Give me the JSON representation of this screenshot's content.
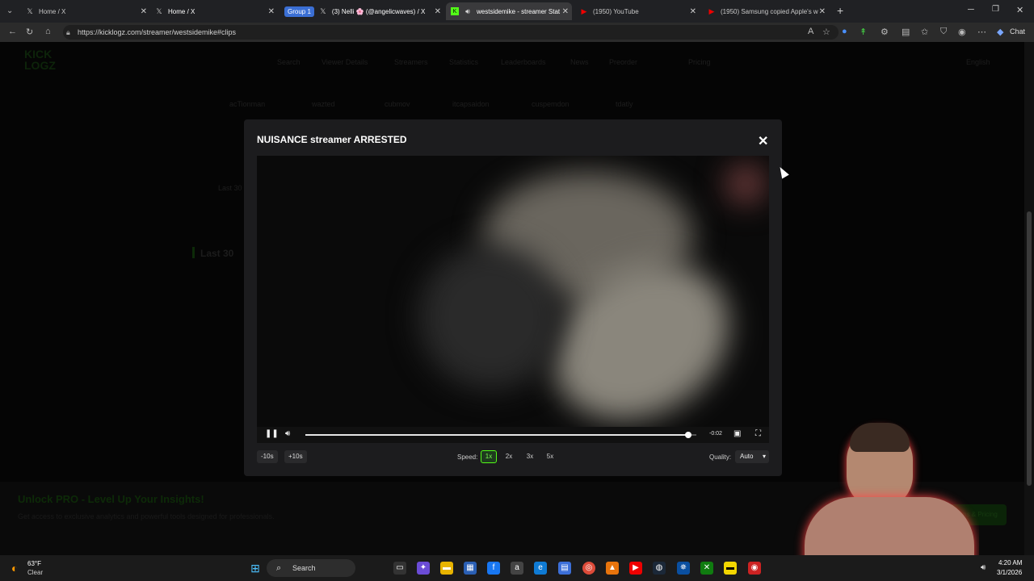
{
  "browser": {
    "tabs": [
      {
        "label": "Home / X",
        "icon": "x-logo-icon"
      },
      {
        "label": "Home / X",
        "icon": "x-logo-icon"
      },
      {
        "group": "Group 1",
        "label": "(3) Nelli 🌸 (@angelicwaves) / X",
        "icon": "x-logo-icon"
      },
      {
        "label": "westsidemike - streamer Stat",
        "icon": "kick-icon",
        "active": true
      },
      {
        "label": "(1950) YouTube",
        "icon": "youtube-icon"
      },
      {
        "label": "(1950) Samsung copied Apple's w",
        "icon": "youtube-icon"
      }
    ],
    "url": "https://kicklogz.com/streamer/westsidemike#clips",
    "chat_label": "Chat"
  },
  "site": {
    "logo": "KICK LOGZ",
    "nav": [
      "Search",
      "Viewer Details",
      "Streamers",
      "Statistics",
      "Leaderboards",
      "News",
      "Preorder",
      "Pricing"
    ],
    "language": "English",
    "users": [
      "acTionman",
      "wazted",
      "cubmov",
      "itcapsaidon",
      "cuspemdon",
      "tdatly"
    ],
    "section_small": "Last 30",
    "section_heading": "Last 30",
    "promo_title": "Unlock PRO - Level Up Your Insights!",
    "promo_sub": "Get access to exclusive analytics and powerful tools designed for professionals.",
    "promo_button": "View Plans & Pricing"
  },
  "modal": {
    "title": "NUISANCE streamer ARRESTED",
    "time_remaining": "-0:02",
    "progress": 0.98,
    "skip_back": "-10s",
    "skip_forward": "+10s",
    "speed_label": "Speed:",
    "speeds": [
      "1x",
      "2x",
      "3x",
      "5x"
    ],
    "active_speed": "1x",
    "quality_label": "Quality:",
    "quality_value": "Auto"
  },
  "taskbar": {
    "temperature": "63°F",
    "weather": "Clear",
    "search": "Search",
    "time": "4:20 AM",
    "date": "3/1/2026"
  }
}
